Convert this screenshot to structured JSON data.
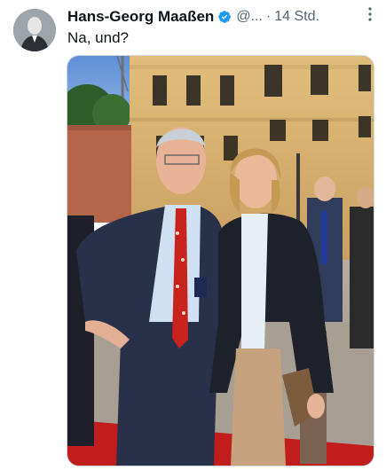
{
  "tweet": {
    "author_name": "Hans-Georg Maaßen",
    "handle": "@...",
    "separator": "·",
    "time": "14 Std.",
    "text": "Na, und?",
    "verified": true,
    "more_icon": "more-vertical-icon",
    "verified_color": "#1d9bf0"
  }
}
